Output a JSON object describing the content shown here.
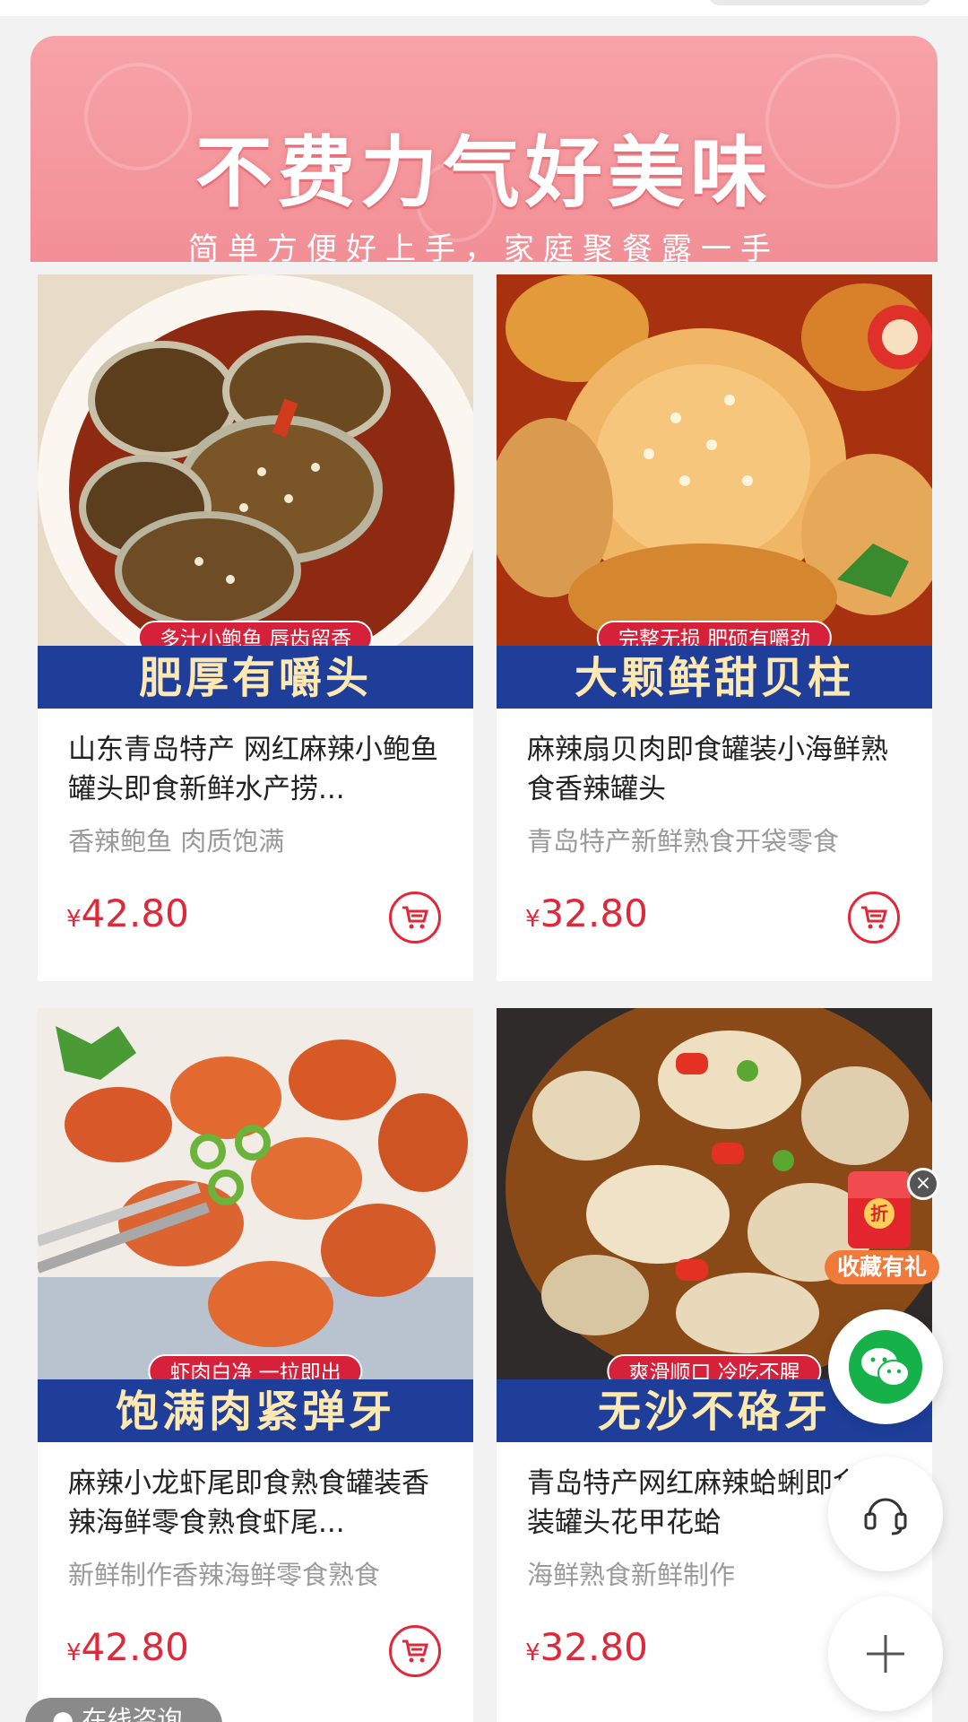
{
  "banner": {
    "title": "不费力气好美味",
    "subtitle": "简单方便好上手，家庭聚餐露一手"
  },
  "products": [
    {
      "tag": "多汁小鲍鱼 唇齿留香",
      "slogan": "肥厚有嚼头",
      "title": "山东青岛特产 网红麻辣小鲍鱼罐头即食新鲜水产捞...",
      "subtitle": "香辣鲍鱼 肉质饱满",
      "currency": "¥",
      "price": "42.80"
    },
    {
      "tag": "完整无损 肥硕有嚼劲",
      "slogan": "大颗鲜甜贝柱",
      "title": "麻辣扇贝肉即食罐装小海鲜熟食香辣罐头",
      "subtitle": "青岛特产新鲜熟食开袋零食",
      "currency": "¥",
      "price": "32.80"
    },
    {
      "tag": "虾肉白净 一拉即出",
      "slogan": "饱满肉紧弹牙",
      "title": "麻辣小龙虾尾即食熟食罐装香辣海鲜零食熟食虾尾...",
      "subtitle": "新鲜制作香辣海鲜零食熟食",
      "currency": "¥",
      "price": "42.80"
    },
    {
      "tag": "爽滑顺口 冷吃不腥",
      "slogan": "无沙不硌牙",
      "title": "青岛特产网红麻辣蛤蜊即食罐装罐头花甲花蛤",
      "subtitle": "海鲜熟食新鲜制作",
      "currency": "¥",
      "price": "32.80"
    }
  ],
  "floating": {
    "gift_coin": "折",
    "gift_label": "收藏有礼",
    "close": "×"
  },
  "bottom_pill": "在线咨询"
}
